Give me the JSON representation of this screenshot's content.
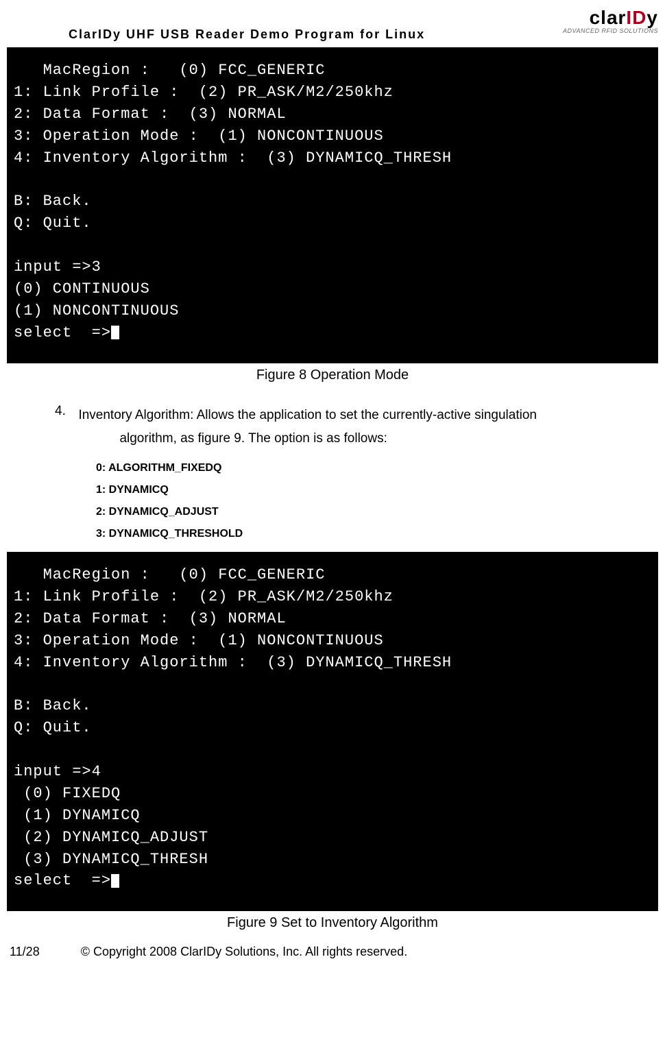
{
  "header": {
    "title": "ClarIDy  UHF  USB  Reader  Demo  Program  for  Linux",
    "logo_clar": "clar",
    "logo_id": "ID",
    "logo_y": "y",
    "logo_sub": "ADVANCED RFID SOLUTIONS"
  },
  "terminal1": {
    "line1": "   MacRegion :   (0) FCC_GENERIC",
    "line2": "1: Link Profile :  (2) PR_ASK/M2/250khz",
    "line3": "2: Data Format :  (3) NORMAL",
    "line4": "3: Operation Mode :  (1) NONCONTINUOUS",
    "line5": "4: Inventory Algorithm :  (3) DYNAMICQ_THRESH",
    "line6": "",
    "line7": "B: Back.",
    "line8": "Q: Quit.",
    "line9": "",
    "line10": "input =>3",
    "line11": "(0) CONTINUOUS",
    "line12": "(1) NONCONTINUOUS",
    "line13": "select  =>"
  },
  "caption1": "Figure 8 Operation Mode",
  "section": {
    "num": "4.",
    "text1": "Inventory Algorithm: Allows the application to set the currently-active singulation",
    "text2": "algorithm, as figure 9. The option is as follows:"
  },
  "options": {
    "o0": "0: ALGORITHM_FIXEDQ",
    "o1": "1: DYNAMICQ",
    "o2": "2: DYNAMICQ_ADJUST",
    "o3": "3: DYNAMICQ_THRESHOLD"
  },
  "terminal2": {
    "line1": "   MacRegion :   (0) FCC_GENERIC",
    "line2": "1: Link Profile :  (2) PR_ASK/M2/250khz",
    "line3": "2: Data Format :  (3) NORMAL",
    "line4": "3: Operation Mode :  (1) NONCONTINUOUS",
    "line5": "4: Inventory Algorithm :  (3) DYNAMICQ_THRESH",
    "line6": "",
    "line7": "B: Back.",
    "line8": "Q: Quit.",
    "line9": "",
    "line10": "input =>4",
    "line11": " (0) FIXEDQ",
    "line12": " (1) DYNAMICQ",
    "line13": " (2) DYNAMICQ_ADJUST",
    "line14": " (3) DYNAMICQ_THRESH",
    "line15": "select  =>"
  },
  "caption2": "Figure 9 Set to Inventory Algorithm",
  "footer": {
    "page": "11/28",
    "copyright": "© Copyright 2008 ClarIDy Solutions, Inc. All rights reserved."
  }
}
